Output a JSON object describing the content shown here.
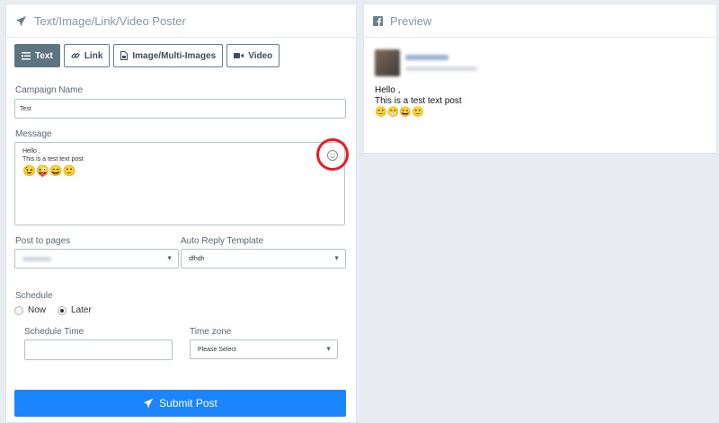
{
  "poster": {
    "title": "Text/Image/Link/Video Poster",
    "tabs": [
      "Text",
      "Link",
      "Image/Multi-Images",
      "Video"
    ],
    "campaign_label": "Campaign Name",
    "campaign_value": "Test",
    "message_label": "Message",
    "message_line1": "Hello ,",
    "message_line2": "This is a test text post",
    "message_emojis": "😉😜😄🙂",
    "post_to_pages_label": "Post to pages",
    "auto_reply_label": "Auto Reply Template",
    "auto_reply_value": "dfhdh",
    "schedule_label": "Schedule",
    "schedule_now": "Now",
    "schedule_later": "Later",
    "schedule_selected": "Later",
    "schedule_time_label": "Schedule Time",
    "time_zone_label": "Time zone",
    "time_zone_value": "Please Select",
    "submit_label": "Submit Post"
  },
  "preview": {
    "title": "Preview",
    "line1": "Hello ,",
    "line2": "This is a test text post",
    "emojis": "🙂😁😄🙂"
  },
  "colors": {
    "primary": "#1b84ff",
    "active_tab": "#5f7481",
    "highlight_ring": "#e21f26"
  }
}
